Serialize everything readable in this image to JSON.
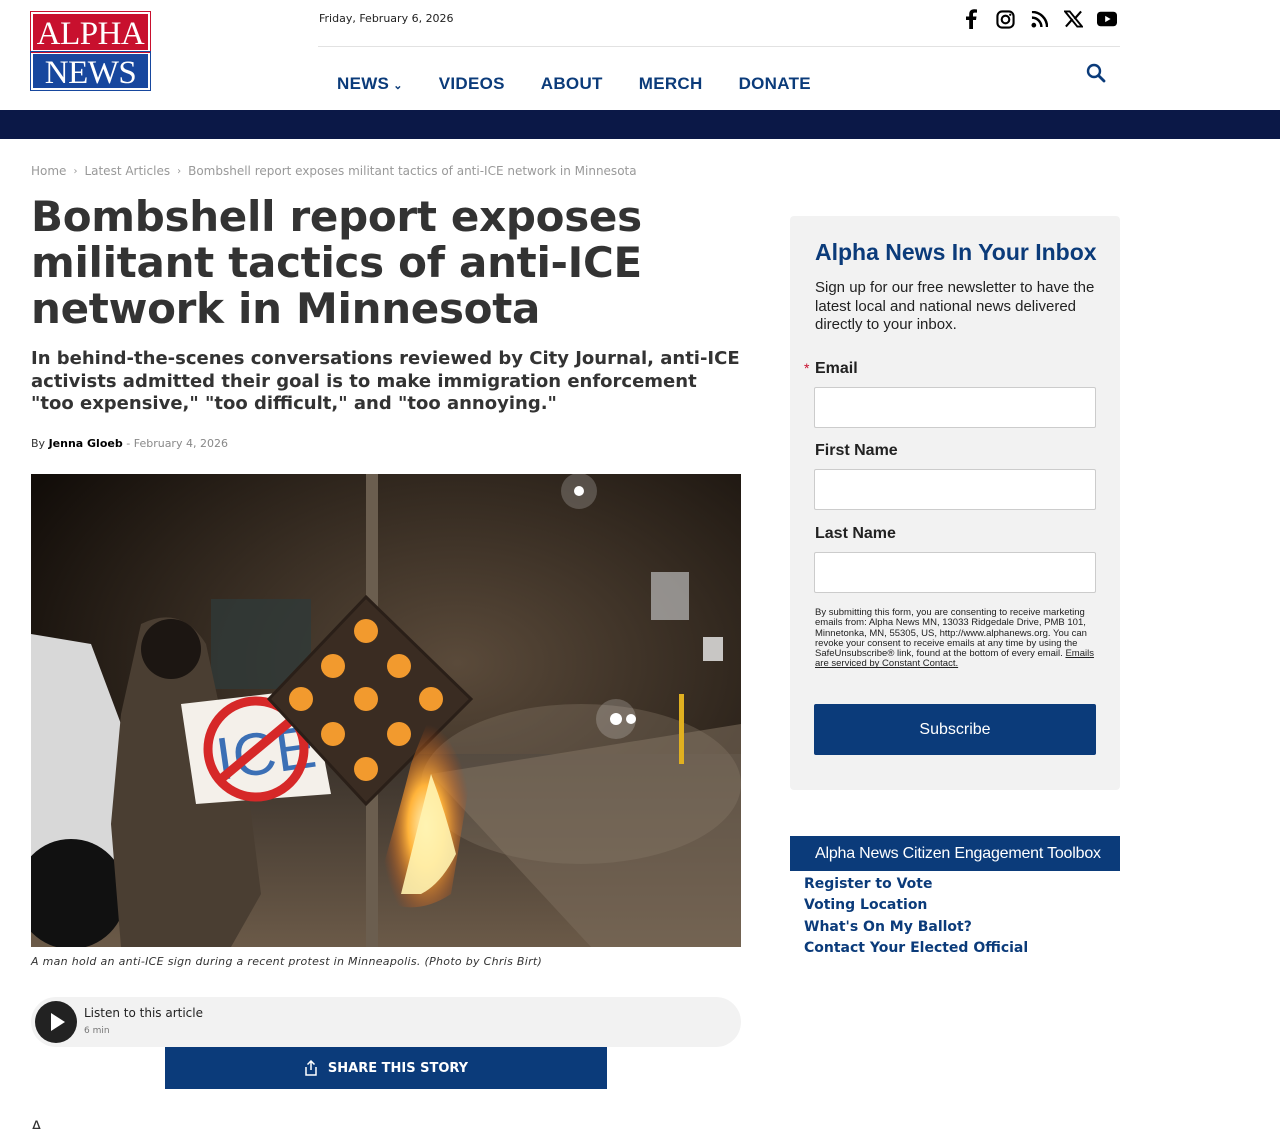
{
  "logo": {
    "line1": "ALPHA",
    "line2": "NEWS"
  },
  "header": {
    "date": "Friday, February 6, 2026",
    "social_icons": [
      "facebook-icon",
      "instagram-icon",
      "rss-icon",
      "x-icon",
      "youtube-icon"
    ]
  },
  "nav": {
    "items": [
      {
        "label": "NEWS",
        "has_dropdown": true
      },
      {
        "label": "VIDEOS"
      },
      {
        "label": "ABOUT"
      },
      {
        "label": "MERCH"
      },
      {
        "label": "DONATE"
      }
    ]
  },
  "breadcrumb": [
    "Home",
    "Latest Articles",
    "Bombshell report exposes militant tactics of anti-ICE network in Minnesota"
  ],
  "article": {
    "title": "Bombshell report exposes militant tactics of anti-ICE network in Minnesota",
    "dek": "In behind-the-scenes conversations reviewed by City Journal, anti-ICE activists admitted their goal is to make immigration enforcement \"too expensive,\" \"too difficult,\" and \"too annoying.\"",
    "by_prefix": "By",
    "author": "Jenna Gloeb",
    "separator": "-",
    "date": "February 4, 2026",
    "photo_sign_text": "ICE",
    "caption": "A man hold an anti-ICE sign during a recent protest in Minneapolis. (Photo by Chris Birt)",
    "body_start": "A."
  },
  "player": {
    "label": "Listen to this article",
    "duration": "6 min"
  },
  "share": {
    "label": "SHARE THIS STORY"
  },
  "newsletter": {
    "title": "Alpha News In Your Inbox",
    "intro": "Sign up for our free newsletter to have the latest local and national news delivered directly to your inbox.",
    "required_mark": "*",
    "email_label": "Email",
    "first_name_label": "First Name",
    "last_name_label": "Last Name",
    "legal": "By submitting this form, you are consenting to receive marketing emails from: Alpha News MN, 13033 Ridgedale Drive, PMB 101, Minnetonka, MN, 55305, US, http://www.alphanews.org. You can revoke your consent to receive emails at any time by using the SafeUnsubscribe® link, found at the bottom of every email.",
    "legal_link": "Emails are serviced by Constant Contact.",
    "subscribe": "Subscribe"
  },
  "toolbox": {
    "title": "Alpha News Citizen Engagement Toolbox",
    "links": [
      "Register to Vote",
      "Voting Location",
      "What's On My Ballot?",
      "Contact Your Elected Official"
    ]
  },
  "colors": {
    "brand_blue": "#0b3b7a",
    "navy_band": "#0b1847",
    "logo_red": "#c8102e"
  }
}
